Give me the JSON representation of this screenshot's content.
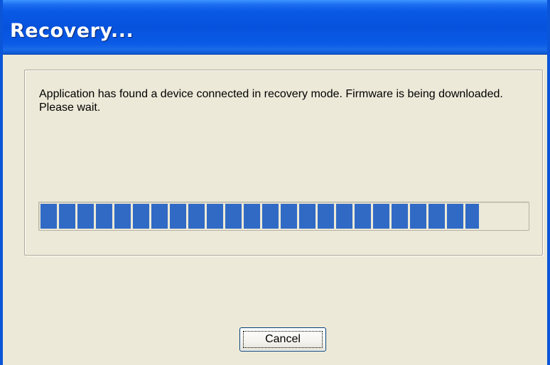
{
  "window": {
    "title": "Recovery..."
  },
  "content": {
    "message": "Application has found a device connected in recovery mode. Firmware is being downloaded. Please wait.",
    "progress_fraction": 0.9
  },
  "buttons": {
    "cancel_label": "Cancel"
  },
  "colors": {
    "titlebar": "#0652dd",
    "window_background": "#ece9d8",
    "progress_block": "#316ac5",
    "button_border": "#003c74"
  }
}
